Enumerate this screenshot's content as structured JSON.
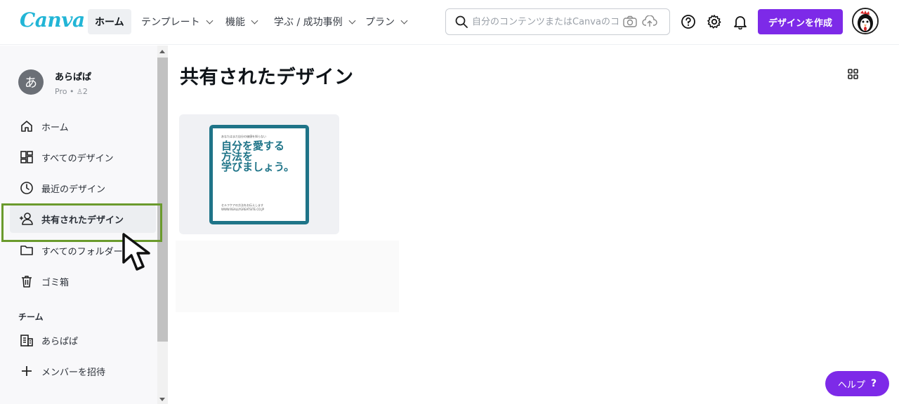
{
  "header": {
    "logo": "Canva",
    "nav": [
      {
        "label": "ホーム",
        "active": true
      },
      {
        "label": "テンプレート"
      },
      {
        "label": "機能"
      },
      {
        "label": "学ぶ / 成功事例"
      },
      {
        "label": "プラン"
      }
    ],
    "search_placeholder": "自分のコンテンツまたはCanvaのコ",
    "create_label": "デザインを作成"
  },
  "sidebar": {
    "user": {
      "initial": "あ",
      "name": "あらぱぱ",
      "plan": "Pro",
      "members": "2"
    },
    "items": [
      {
        "label": "ホーム",
        "icon": "home-icon"
      },
      {
        "label": "すべてのデザイン",
        "icon": "grid-layout-icon"
      },
      {
        "label": "最近のデザイン",
        "icon": "clock-icon"
      },
      {
        "label": "共有されたデザイン",
        "icon": "shared-users-icon",
        "active": true
      },
      {
        "label": "すべてのフォルダー",
        "icon": "folder-icon"
      },
      {
        "label": "ゴミ箱",
        "icon": "trash-icon"
      }
    ],
    "team_section": "チーム",
    "team_items": [
      {
        "label": "あらぱぱ",
        "icon": "building-icon"
      },
      {
        "label": "メンバーを招待",
        "icon": "plus-icon"
      }
    ]
  },
  "main": {
    "title": "共有されたデザイン",
    "design": {
      "small_top": "あなたはまだ自分の価値を知らない",
      "headline": [
        "自分を愛する",
        "方法を",
        "学びましょう。"
      ],
      "footer_line1": "セルフケアの方法をお伝えします",
      "footer_line2": "WWW.REALLYGREATSITE.CO.JP"
    }
  },
  "help_label": "ヘルプ",
  "help_mark": "?",
  "colors": {
    "accent": "#7d2ae8",
    "logo": "#22b5d6",
    "highlight": "#6a9a2c",
    "design_teal": "#1f7488"
  }
}
